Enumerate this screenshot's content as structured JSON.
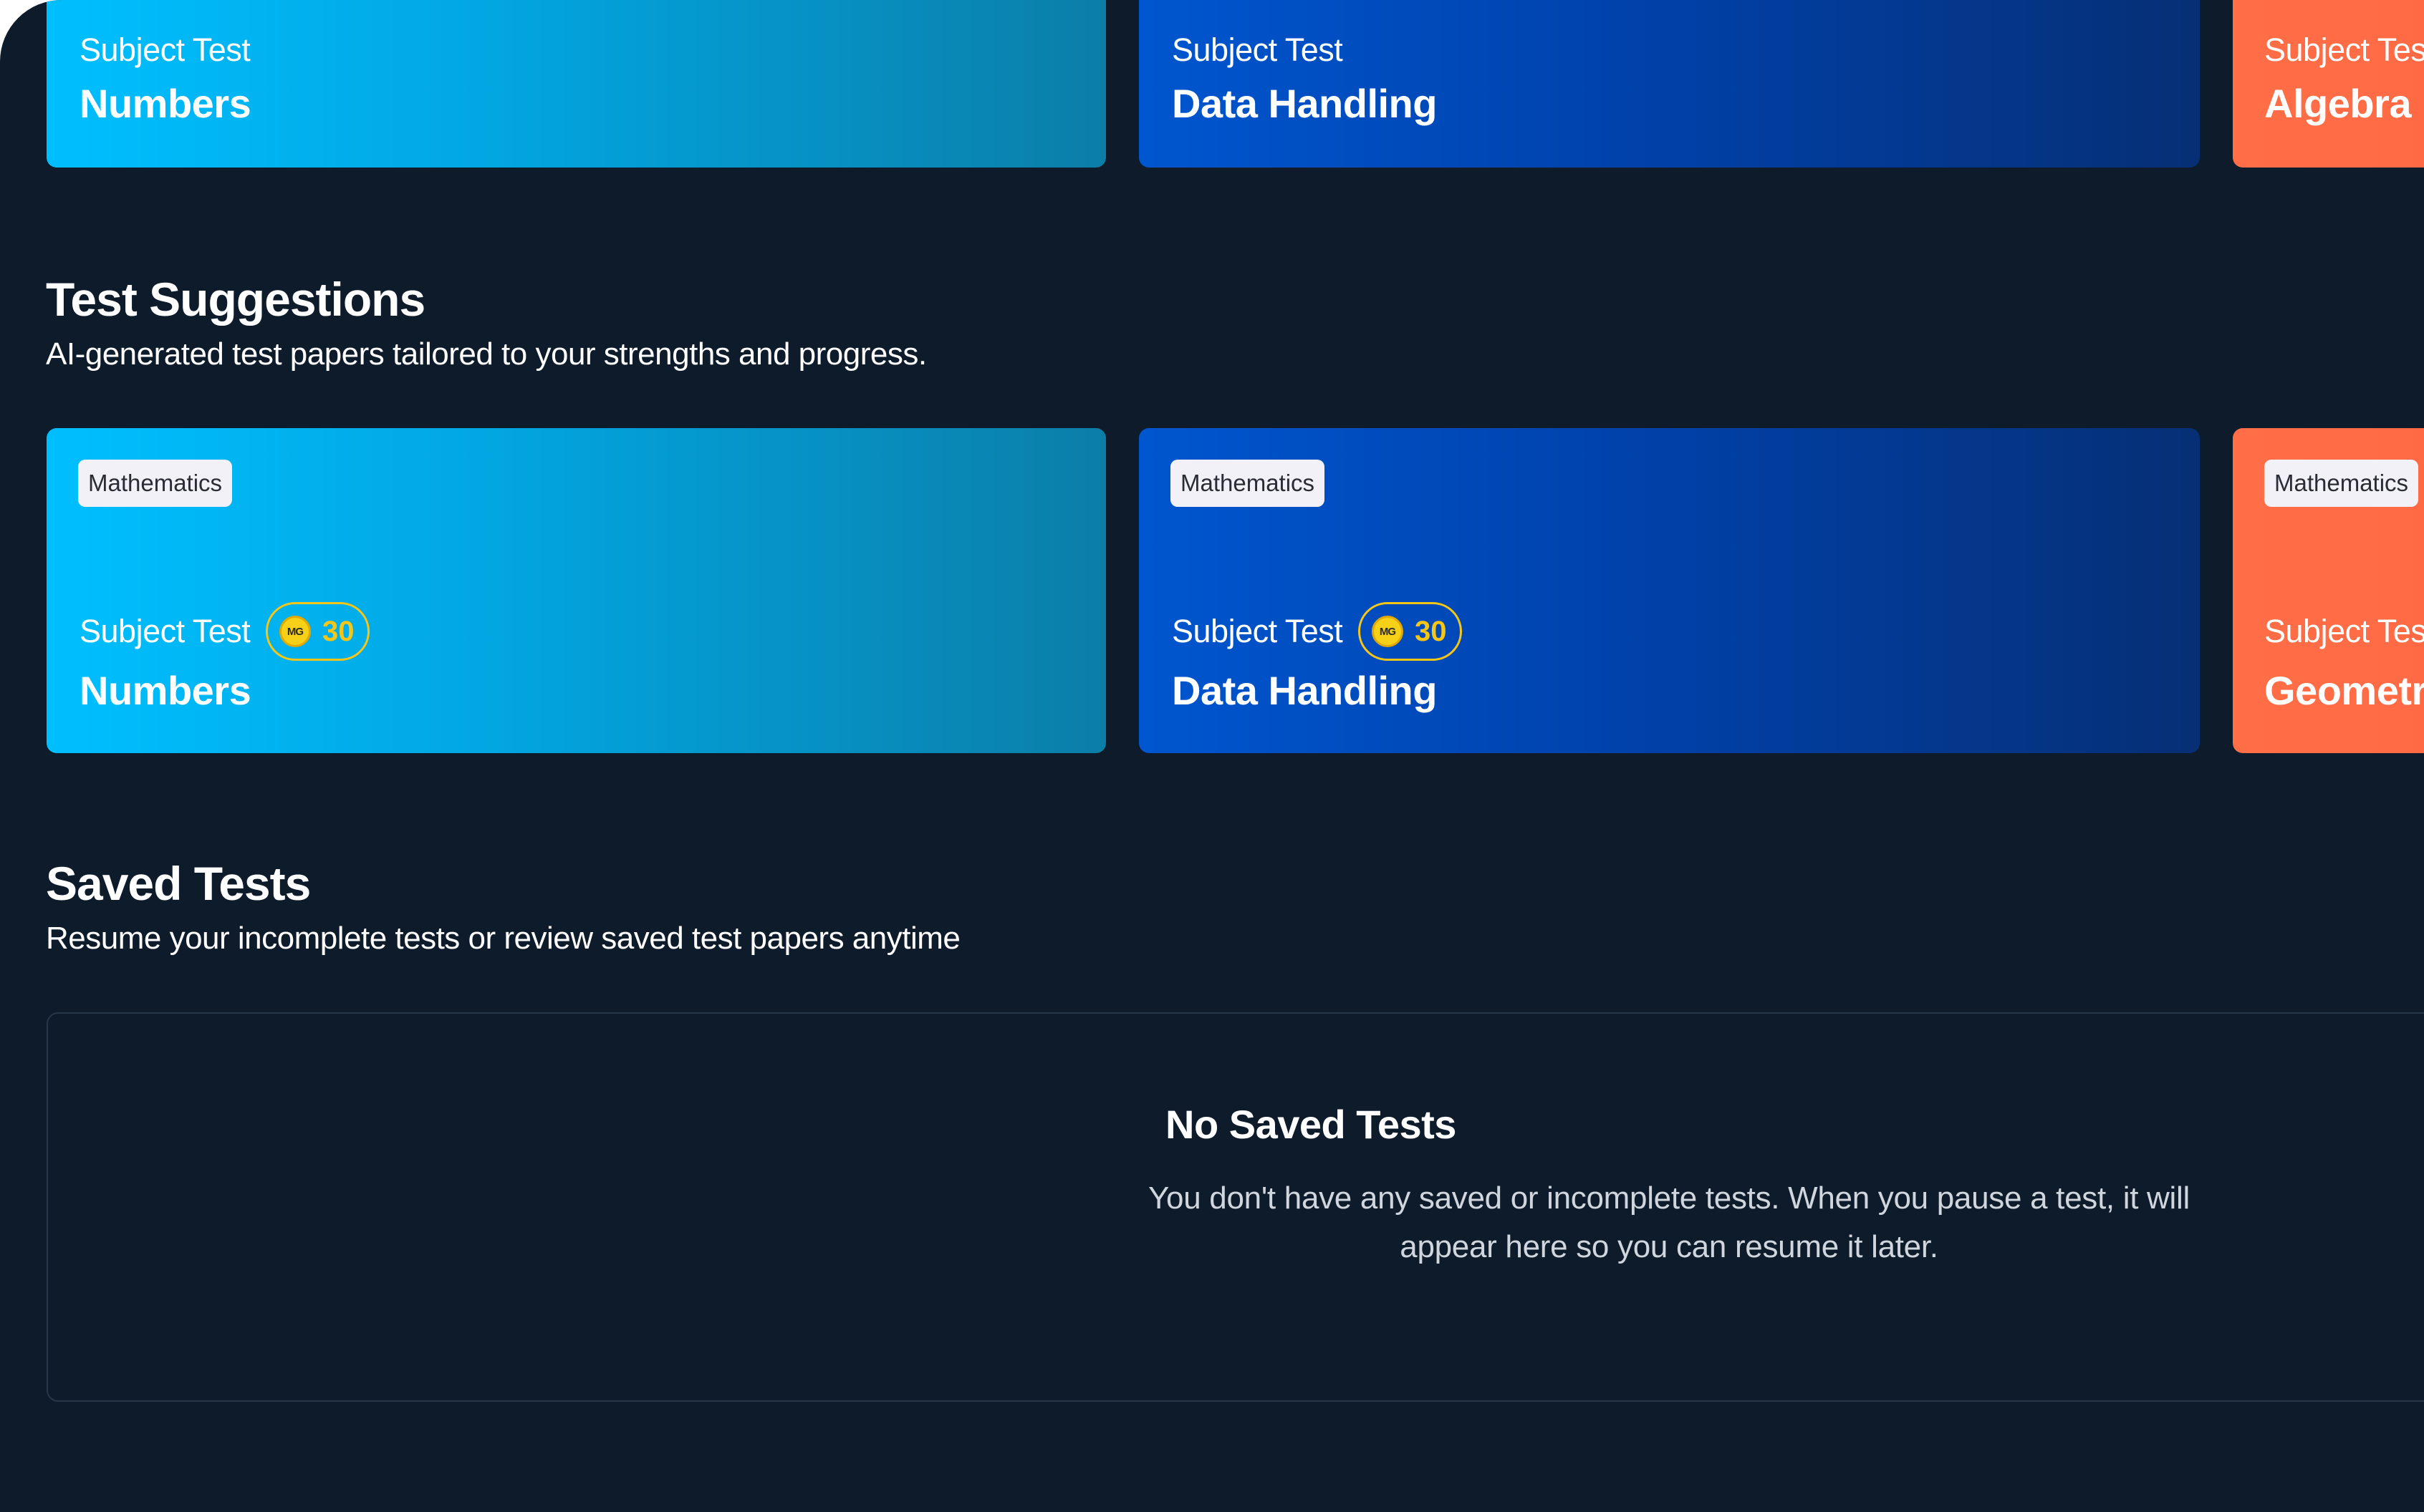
{
  "top_row": [
    {
      "kicker": "Subject Test",
      "title": "Numbers"
    },
    {
      "kicker": "Subject Test",
      "title": "Data Handling"
    },
    {
      "kicker": "Subject Tes",
      "title": "Algebra"
    }
  ],
  "suggestions": {
    "title": "Test Suggestions",
    "subtitle": "AI-generated test papers tailored to your strengths and progress.",
    "cards": [
      {
        "chip": "Mathematics",
        "kicker": "Subject Test",
        "coin_icon_text": "MG",
        "coins": "30",
        "title": "Numbers"
      },
      {
        "chip": "Mathematics",
        "kicker": "Subject Test",
        "coin_icon_text": "MG",
        "coins": "30",
        "title": "Data Handling"
      },
      {
        "chip": "Mathematics",
        "kicker": "Subject Tes",
        "title": "Geometr"
      }
    ]
  },
  "saved": {
    "title": "Saved Tests",
    "subtitle": "Resume your incomplete tests or review saved test papers anytime",
    "empty_title": "No Saved Tests",
    "empty_text": "You don't have any saved or incomplete tests. When you pause a test, it will appear here so you can resume it later."
  },
  "colors": {
    "background": "#0d1b2a",
    "card_light_blue": "#00bfff",
    "card_dark_blue": "#0042ac",
    "card_orange": "#ff6e47",
    "coin_gold": "#f5c518"
  },
  "icons": {
    "coin": "coin-icon"
  }
}
